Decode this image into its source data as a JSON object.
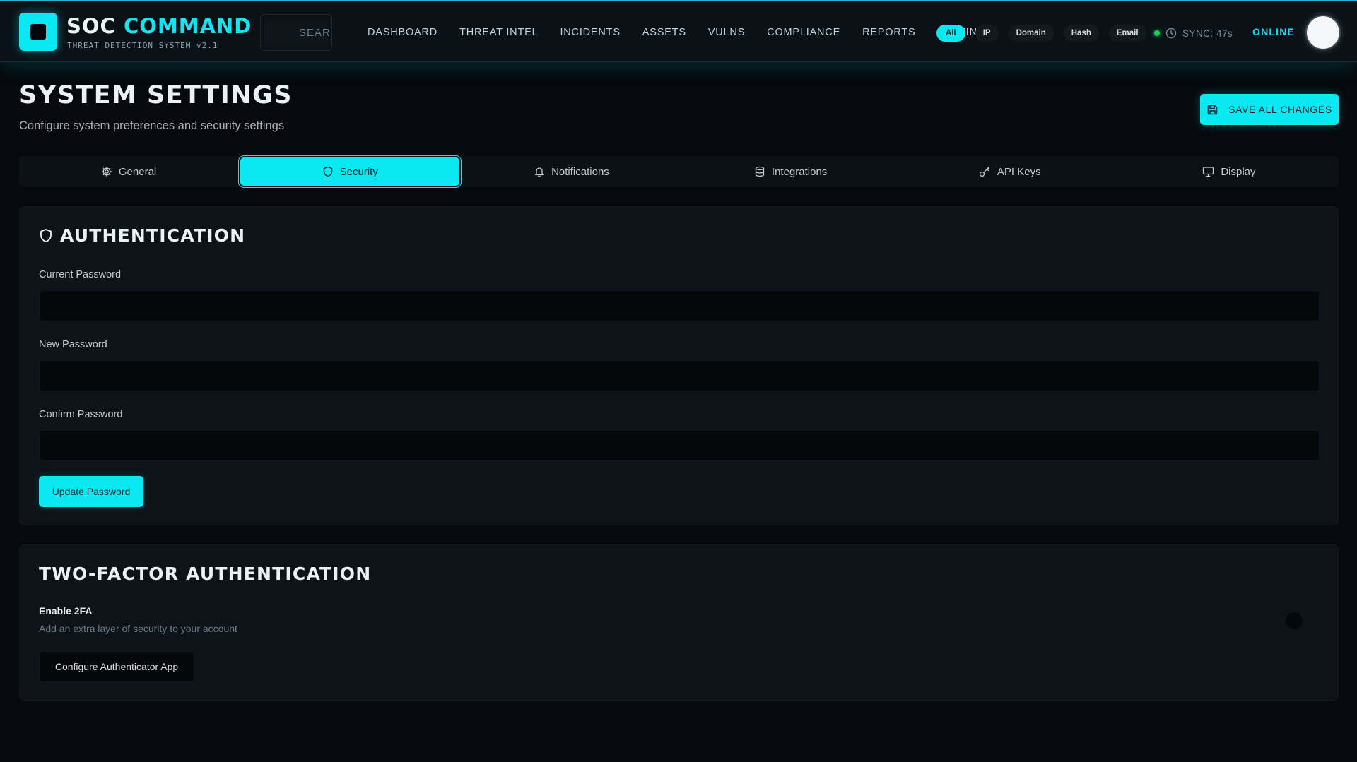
{
  "header": {
    "brand_primary": "SOC",
    "brand_accent": "COMMAND",
    "brand_subtitle": "THREAT DETECTION SYSTEM v2.1",
    "search_placeholder": "SEARCH",
    "nav": [
      "DASHBOARD",
      "THREAT INTEL",
      "INCIDENTS",
      "ASSETS",
      "VULNS",
      "COMPLIANCE",
      "REPORTS",
      "SETTINGS"
    ],
    "filters": [
      {
        "label": "All",
        "active": true
      },
      {
        "label": "IP",
        "active": false
      },
      {
        "label": "Domain",
        "active": false
      },
      {
        "label": "Hash",
        "active": false
      },
      {
        "label": "Email",
        "active": false
      }
    ],
    "sync_text": "SYNC: 47s",
    "status": "ONLINE"
  },
  "page": {
    "title": "SYSTEM SETTINGS",
    "subtitle": "Configure system preferences and security settings",
    "save_label": "SAVE ALL CHANGES"
  },
  "tabs": [
    {
      "label": "General",
      "icon": "gear-icon",
      "active": false
    },
    {
      "label": "Security",
      "icon": "shield-icon",
      "active": true
    },
    {
      "label": "Notifications",
      "icon": "bell-icon",
      "active": false
    },
    {
      "label": "Integrations",
      "icon": "database-icon",
      "active": false
    },
    {
      "label": "API Keys",
      "icon": "key-icon",
      "active": false
    },
    {
      "label": "Display",
      "icon": "monitor-icon",
      "active": false
    }
  ],
  "authentication": {
    "title": "AUTHENTICATION",
    "current_password_label": "Current Password",
    "current_password_value": "",
    "new_password_label": "New Password",
    "new_password_value": "",
    "confirm_password_label": "Confirm Password",
    "confirm_password_value": "",
    "update_label": "Update Password"
  },
  "two_factor": {
    "title": "TWO-FACTOR AUTHENTICATION",
    "enable_label": "Enable 2FA",
    "enable_desc": "Add an extra layer of security to your account",
    "enabled": false,
    "configure_label": "Configure Authenticator App"
  },
  "colors": {
    "accent": "#0ae8f2",
    "background": "#06090d",
    "card": "#0d1318",
    "online_dot": "#22c55e"
  }
}
